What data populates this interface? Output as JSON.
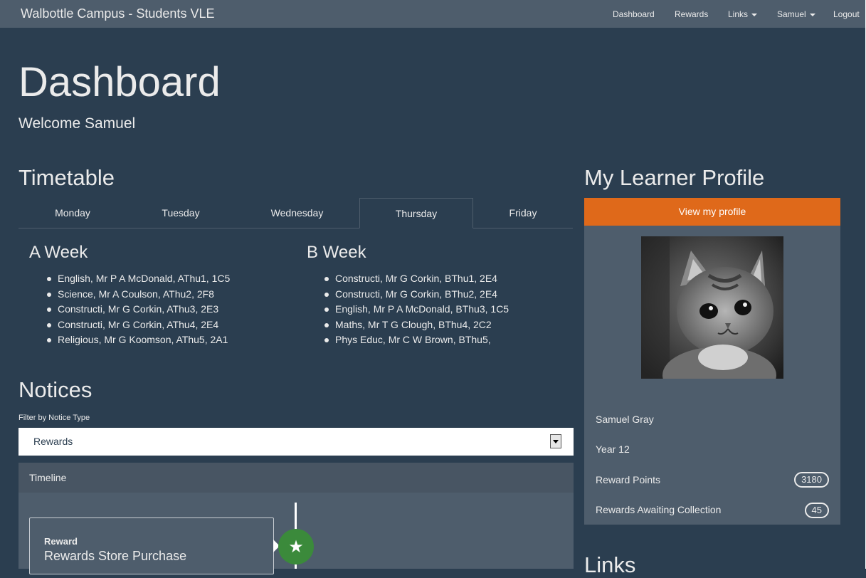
{
  "navbar": {
    "brand": "Walbottle Campus - Students VLE",
    "items": [
      {
        "label": "Dashboard"
      },
      {
        "label": "Rewards"
      },
      {
        "label": "Links"
      },
      {
        "label": "Samuel"
      },
      {
        "label": "Logout"
      }
    ]
  },
  "page": {
    "title": "Dashboard",
    "welcome": "Welcome Samuel"
  },
  "timetable": {
    "heading": "Timetable",
    "tabs": [
      "Monday",
      "Tuesday",
      "Wednesday",
      "Thursday",
      "Friday"
    ],
    "active_tab": "Thursday",
    "a_week": {
      "title": "A Week",
      "items": [
        "English, Mr P A McDonald, AThu1, 1C5",
        "Science, Mr A Coulson, AThu2, 2F8",
        "Constructi, Mr G Corkin, AThu3, 2E3",
        "Constructi, Mr G Corkin, AThu4, 2E4",
        "Religious, Mr G Koomson, AThu5, 2A1"
      ]
    },
    "b_week": {
      "title": "B Week",
      "items": [
        "Constructi, Mr G Corkin, BThu1, 2E4",
        "Constructi, Mr G Corkin, BThu2, 2E4",
        "English, Mr P A McDonald, BThu3, 1C5",
        "Maths, Mr T G Clough, BThu4, 2C2",
        "Phys Educ, Mr C W Brown, BThu5,"
      ]
    }
  },
  "notices": {
    "heading": "Notices",
    "filter_label": "Filter by Notice Type",
    "filter_value": "Rewards",
    "timeline": {
      "heading": "Timeline",
      "entries": [
        {
          "type": "Reward",
          "text": "Rewards Store Purchase",
          "icon": "star-icon",
          "color": "#3b8a3b"
        }
      ]
    }
  },
  "profile": {
    "heading": "My Learner Profile",
    "button": "View my profile",
    "photo": "kitten-photo",
    "name": "Samuel Gray",
    "year": "Year 12",
    "reward_points_label": "Reward Points",
    "reward_points": "3180",
    "awaiting_label": "Rewards Awaiting Collection",
    "awaiting": "45"
  },
  "links": {
    "heading": "Links"
  },
  "colors": {
    "background": "#2b3e50",
    "navbar": "#4e5d6c",
    "accent": "#df691a",
    "panel": "#4e5d6c"
  }
}
